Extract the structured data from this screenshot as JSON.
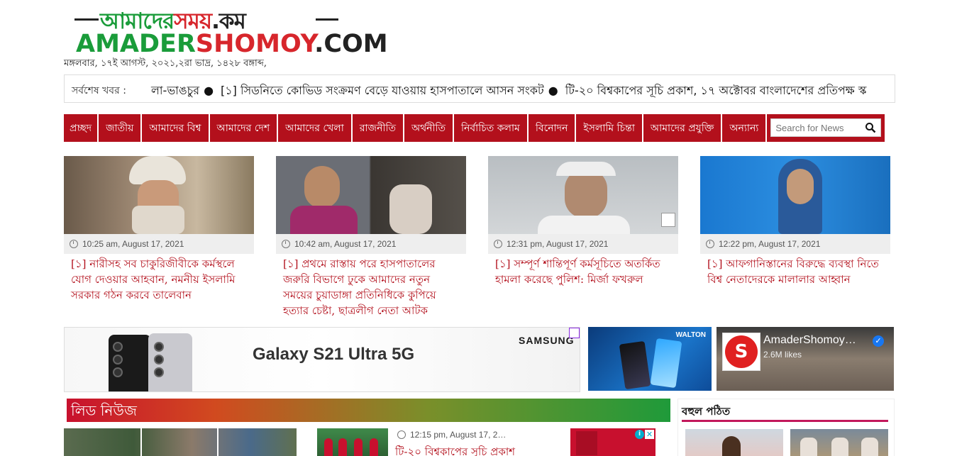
{
  "logo": {
    "bn_text_a": "আমাদের",
    "bn_text_b": "সময়",
    "bn_text_c": ".কম",
    "en_text_a": "AMADER",
    "en_text_b": "SHOMOY",
    "en_text_c": ".COM"
  },
  "date_line": "মঙ্গলবার, ১৭ই আগস্ট, ২০২১,২রা ভাদ্র, ১৪২৮ বঙ্গাব্দ,",
  "ticker": {
    "label": "সর্বশেষ খবর :",
    "items": [
      "লা-ভাঙচুর",
      "[১] সিডনিতে কোভিড সংক্রমণ বেড়ে যাওয়ায় হাসপাতালে আসন সংকট",
      "টি-২০ বিশ্বকাপের সূচি প্রকাশ, ১৭ অক্টোবর বাংলাদেশের প্রতিপক্ষ স্ক"
    ],
    "separator": "●"
  },
  "nav": {
    "items": [
      "প্রচ্ছদ",
      "জাতীয়",
      "আমাদের বিশ্ব",
      "আমাদের দেশ",
      "আমাদের খেলা",
      "রাজনীতি",
      "অর্থনীতি",
      "নির্বাচিত কলাম",
      "বিনোদন",
      "ইসলামি চিন্তা",
      "আমাদের প্রযুক্তি",
      "অন্যান্য"
    ],
    "search_placeholder": "Search for News",
    "accent_color": "#b3101c"
  },
  "cards": [
    {
      "time": "10:25 am, August 17, 2021",
      "title": "[১] নারীসহ সব চাকুরিজীবীকে কর্মস্থলে যোগ দেওয়ার আহবান, নমনীয় ইসলামি সরকার গঠন করবে তালেবান"
    },
    {
      "time": "10:42 am, August 17, 2021",
      "title": "[১] প্রথমে রাস্তায় পরে হাসপাতালের জরুরি বিভাগে ঢুকে আমাদের নতুন সময়ের চুয়াডাঙ্গা প্রতিনিধিকে কুপিয়ে হত্যার চেষ্টা, ছাত্রলীগ নেতা আটক"
    },
    {
      "time": "12:31 pm, August 17, 2021",
      "title": "[১] সম্পূর্ণ শান্তিপূর্ণ কর্মসূচিতে অতর্কিত হামলা করেছে পুলিশ: মির্জা ফখরুল"
    },
    {
      "time": "12:22 pm, August 17, 2021",
      "title": "[১] আফগানিস্তানের বিরুদ্ধে ব্যবস্থা নিতে বিশ্ব নেতাদেরকে মালালার আহ্বান"
    }
  ],
  "ads": {
    "samsung_text": "Galaxy S21 Ultra 5G",
    "samsung_brand": "SAMSUNG",
    "walton_brand": "WALTON",
    "fb_name": "AmaderShomoy…",
    "fb_likes": "2.6M likes"
  },
  "sections": {
    "lead_news": "লিড নিউজ",
    "most_read": "বহুল পঠিত"
  },
  "bottom_story": {
    "time": "12:15 pm, August 17, 2…",
    "title": "টি-২০ বিশ্বকাপের সূচি প্রকাশ"
  }
}
